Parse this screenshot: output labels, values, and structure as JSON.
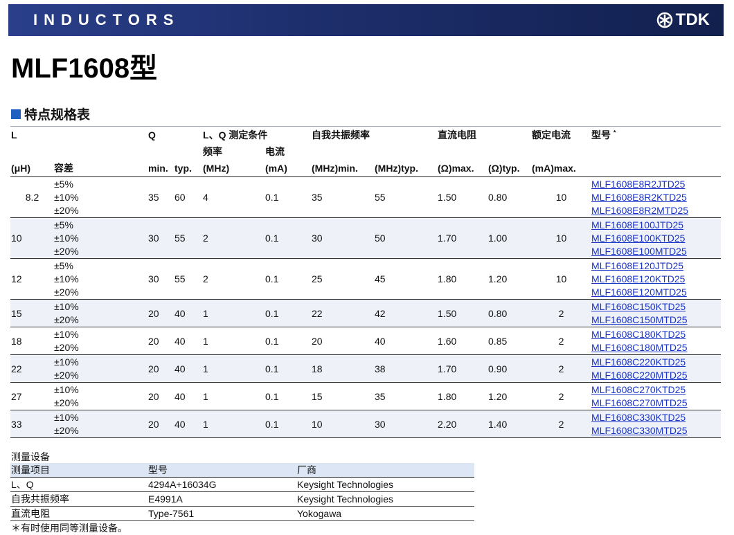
{
  "banner": {
    "title": "INDUCTORS",
    "brand": "TDK"
  },
  "page": {
    "title": "MLF1608型",
    "section": "特点规格表"
  },
  "spec_table": {
    "headers": {
      "L": "L",
      "Q": "Q",
      "cond": "L、Q 测定条件",
      "srf": "自我共振频率",
      "rdc": "直流电阻",
      "current": "额定电流",
      "model": "型号",
      "model_mark": "*",
      "freq": "频率",
      "curr_ma": "电流",
      "uh": "(μH)",
      "tol": "容差",
      "qmin": "min.",
      "qtyp": "typ.",
      "mhz": "(MHz)",
      "ma": "(mA)",
      "srf_min": "(MHz)min.",
      "srf_typ": "(MHz)typ.",
      "rdc_max": "(Ω)max.",
      "rdc_typ": "(Ω)typ.",
      "cur_max": "(mA)max."
    },
    "rows": [
      {
        "l": "8.2",
        "tol": [
          "±5%",
          "±10%",
          "±20%"
        ],
        "qmin": "35",
        "qtyp": "60",
        "freq": "4",
        "curr": "0.1",
        "srf_min": "35",
        "srf_typ": "55",
        "rdc_max": "1.50",
        "rdc_typ": "0.80",
        "rated": "10",
        "parts": [
          "MLF1608E8R2JTD25",
          "MLF1608E8R2KTD25",
          "MLF1608E8R2MTD25"
        ]
      },
      {
        "l": "10",
        "tol": [
          "±5%",
          "±10%",
          "±20%"
        ],
        "qmin": "30",
        "qtyp": "55",
        "freq": "2",
        "curr": "0.1",
        "srf_min": "30",
        "srf_typ": "50",
        "rdc_max": "1.70",
        "rdc_typ": "1.00",
        "rated": "10",
        "parts": [
          "MLF1608E100JTD25",
          "MLF1608E100KTD25",
          "MLF1608E100MTD25"
        ]
      },
      {
        "l": "12",
        "tol": [
          "±5%",
          "±10%",
          "±20%"
        ],
        "qmin": "30",
        "qtyp": "55",
        "freq": "2",
        "curr": "0.1",
        "srf_min": "25",
        "srf_typ": "45",
        "rdc_max": "1.80",
        "rdc_typ": "1.20",
        "rated": "10",
        "parts": [
          "MLF1608E120JTD25",
          "MLF1608E120KTD25",
          "MLF1608E120MTD25"
        ]
      },
      {
        "l": "15",
        "tol": [
          "±10%",
          "±20%"
        ],
        "qmin": "20",
        "qtyp": "40",
        "freq": "1",
        "curr": "0.1",
        "srf_min": "22",
        "srf_typ": "42",
        "rdc_max": "1.50",
        "rdc_typ": "0.80",
        "rated": "2",
        "parts": [
          "MLF1608C150KTD25",
          "MLF1608C150MTD25"
        ]
      },
      {
        "l": "18",
        "tol": [
          "±10%",
          "±20%"
        ],
        "qmin": "20",
        "qtyp": "40",
        "freq": "1",
        "curr": "0.1",
        "srf_min": "20",
        "srf_typ": "40",
        "rdc_max": "1.60",
        "rdc_typ": "0.85",
        "rated": "2",
        "parts": [
          "MLF1608C180KTD25",
          "MLF1608C180MTD25"
        ]
      },
      {
        "l": "22",
        "tol": [
          "±10%",
          "±20%"
        ],
        "qmin": "20",
        "qtyp": "40",
        "freq": "1",
        "curr": "0.1",
        "srf_min": "18",
        "srf_typ": "38",
        "rdc_max": "1.70",
        "rdc_typ": "0.90",
        "rated": "2",
        "parts": [
          "MLF1608C220KTD25",
          "MLF1608C220MTD25"
        ]
      },
      {
        "l": "27",
        "tol": [
          "±10%",
          "±20%"
        ],
        "qmin": "20",
        "qtyp": "40",
        "freq": "1",
        "curr": "0.1",
        "srf_min": "15",
        "srf_typ": "35",
        "rdc_max": "1.80",
        "rdc_typ": "1.20",
        "rated": "2",
        "parts": [
          "MLF1608C270KTD25",
          "MLF1608C270MTD25"
        ]
      },
      {
        "l": "33",
        "tol": [
          "±10%",
          "±20%"
        ],
        "qmin": "20",
        "qtyp": "40",
        "freq": "1",
        "curr": "0.1",
        "srf_min": "10",
        "srf_typ": "30",
        "rdc_max": "2.20",
        "rdc_typ": "1.40",
        "rated": "2",
        "parts": [
          "MLF1608C330KTD25",
          "MLF1608C330MTD25"
        ]
      }
    ]
  },
  "equipment": {
    "label": "测量设备",
    "headers": [
      "测量项目",
      "型号",
      "厂商"
    ],
    "rows": [
      [
        "L、Q",
        "4294A+16034G",
        "Keysight Technologies"
      ],
      [
        "自我共振频率",
        "E4991A",
        "Keysight Technologies"
      ],
      [
        "直流电阻",
        "Type-7561",
        "Yokogawa"
      ]
    ]
  },
  "footnote": "＊有时使用同等测量设备。"
}
